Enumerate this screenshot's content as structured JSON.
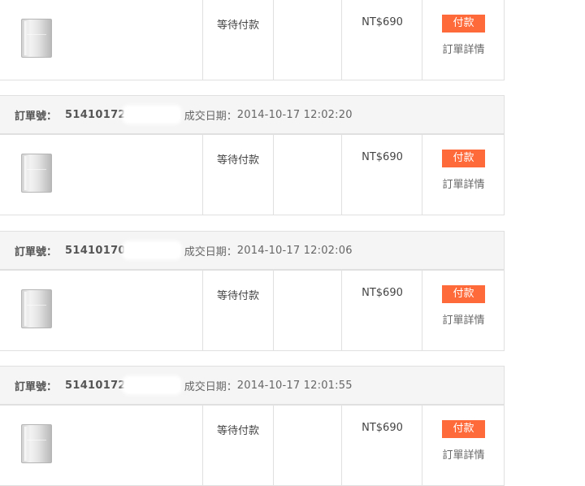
{
  "header_labels": {
    "order_no": "訂單號：",
    "order_date": "成交日期："
  },
  "orders": [
    {
      "order_no": "",
      "order_date": "",
      "status": "等待付款",
      "price": "NT$690",
      "pay_label": "付款",
      "detail_label": "訂單詳情"
    },
    {
      "order_no": "51410172",
      "order_date": "2014-10-17 12:02:20",
      "status": "等待付款",
      "price": "NT$690",
      "pay_label": "付款",
      "detail_label": "訂單詳情"
    },
    {
      "order_no": "51410170",
      "order_date": "2014-10-17 12:02:06",
      "status": "等待付款",
      "price": "NT$690",
      "pay_label": "付款",
      "detail_label": "訂單詳情"
    },
    {
      "order_no": "51410172",
      "order_date": "2014-10-17 12:01:55",
      "status": "等待付款",
      "price": "NT$690",
      "pay_label": "付款",
      "detail_label": "訂單詳情"
    }
  ],
  "colors": {
    "pay_button": "#ff6a3a",
    "header_bg": "#f5f5f5",
    "border": "#e0e0e0"
  },
  "icons": {
    "product": "power-bank-thumbnail"
  }
}
